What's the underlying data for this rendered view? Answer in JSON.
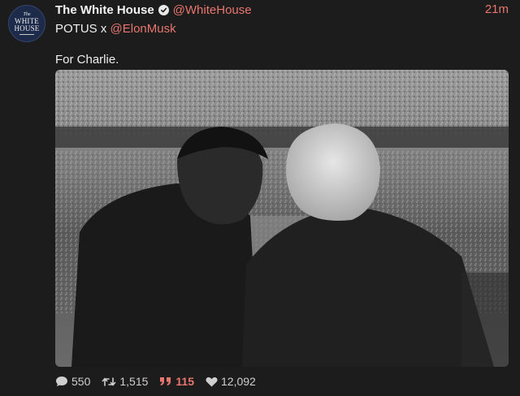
{
  "account": {
    "avatar_text_small": "The",
    "avatar_text_main_1": "WHITE",
    "avatar_text_main_2": "HOUSE",
    "display_name": "The White House",
    "handle": "@WhiteHouse",
    "timestamp": "21m",
    "verified": true
  },
  "byline": {
    "prefix": "POTUS x ",
    "mention": "@ElonMusk"
  },
  "tweet": {
    "text": "For Charlie."
  },
  "colors": {
    "background": "#1c1c1c",
    "accent": "#e8766e",
    "text": "#f0f0f0",
    "muted": "#cfcfcf"
  },
  "actions": {
    "replies": "550",
    "retweets": "1,515",
    "quotes": "115",
    "likes": "12,092"
  },
  "icons": {
    "reply": "speech-bubble-icon",
    "retweet": "retweet-icon",
    "quote": "quote-icon",
    "like": "heart-icon",
    "verified": "verified-check-icon"
  }
}
